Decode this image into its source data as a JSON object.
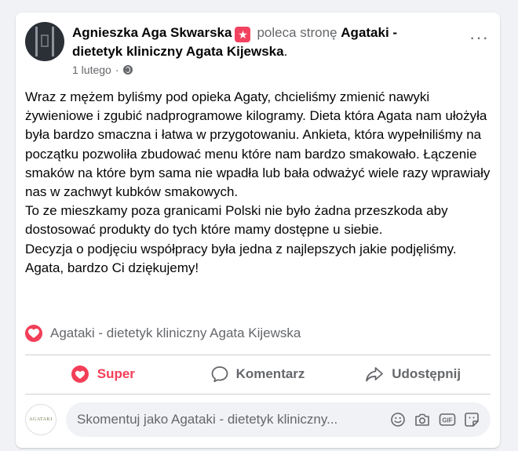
{
  "post": {
    "author": "Agnieszka Aga Skwarska",
    "recommends_text": "poleca stronę",
    "page_name": "Agataki - dietetyk kliniczny Agata Kijewska",
    "date": "1 lutego",
    "separator": "·",
    "more_label": "···",
    "body_lines": [
      "Wraz z mężem byliśmy pod opieka Agaty, chcieliśmy zmienić nawyki żywieniowe i zgubić nadprogramowe kilogramy. Dieta która Agata nam ułożyła była bardzo smaczna i łatwa w przygotowaniu. Ankieta, która wypełniliśmy na początku pozwoliła zbudować menu które nam bardzo smakowało. Łączenie smaków na które bym sama nie wpadła lub bała odważyć wiele razy wprawiały nas w zachwyt kubków smakowych.",
      "To ze mieszkamy poza granicami Polski nie było żadna przeszkoda aby dostosować produkty do tych które mamy dostępne u siebie.",
      "Decyzja o podjęciu współpracy była jedna z najlepszych jakie podjęliśmy.",
      "Agata, bardzo Ci dziękujemy!"
    ]
  },
  "reactions": {
    "label": "Agataki - dietetyk kliniczny Agata Kijewska",
    "icon": "heart-icon"
  },
  "actions": {
    "super": "Super",
    "comment": "Komentarz",
    "share": "Udostępnij"
  },
  "comment": {
    "placeholder": "Skomentuj jako Agataki - dietetyk kliniczny...",
    "page_avatar_text": "AGATAKI",
    "icons": [
      "emoji-icon",
      "camera-icon",
      "gif-icon",
      "sticker-icon"
    ]
  },
  "colors": {
    "accent_red": "#f33e58",
    "secondary_text": "#65676b",
    "primary_text": "#050505"
  }
}
